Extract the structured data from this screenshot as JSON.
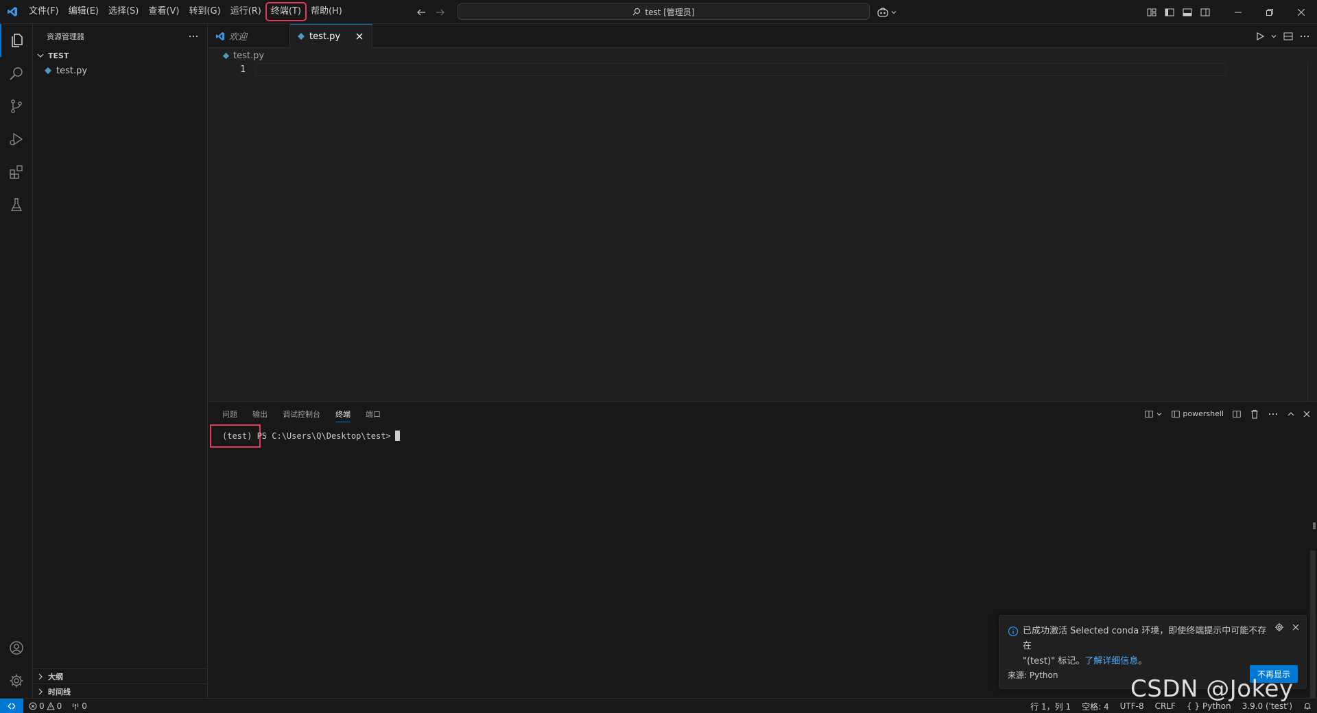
{
  "titlebar": {
    "menu": [
      "文件(F)",
      "编辑(E)",
      "选择(S)",
      "查看(V)",
      "转到(G)",
      "运行(R)",
      "终端(T)",
      "帮助(H)"
    ],
    "search_text": "test [管理员]"
  },
  "sidebar": {
    "title": "资源管理器",
    "folder": "TEST",
    "files": [
      "test.py"
    ],
    "outline_label": "大纲",
    "timeline_label": "时间线"
  },
  "tabs": [
    {
      "label": "欢迎",
      "active": false
    },
    {
      "label": "test.py",
      "active": true
    }
  ],
  "editor": {
    "breadcrumb": "test.py",
    "line_number": "1"
  },
  "panel": {
    "tabs": [
      "问题",
      "输出",
      "调试控制台",
      "终端",
      "端口"
    ],
    "active_tab": "终端",
    "shell_name": "powershell",
    "terminal_line": "(test) PS C:\\Users\\Q\\Desktop\\test>"
  },
  "notification": {
    "message_1": "已成功激活 Selected conda 环境，即使终端提示中可能不存在",
    "message_2": "\"(test)\" 标记。",
    "link": "了解详细信息",
    "message_end": "。",
    "source": "来源: Python",
    "button": "不再显示"
  },
  "statusbar": {
    "errors": "0",
    "warnings": "0",
    "ports": "0",
    "position": "行 1，列 1",
    "spaces": "空格: 4",
    "encoding": "UTF-8",
    "eol": "CRLF",
    "language": "Python",
    "interpreter": "3.9.0 ('test')"
  },
  "watermark": "CSDN @Jokey",
  "colors": {
    "accent": "#0078d4",
    "highlight_box": "#e5395b",
    "python_file": "#519aba"
  }
}
